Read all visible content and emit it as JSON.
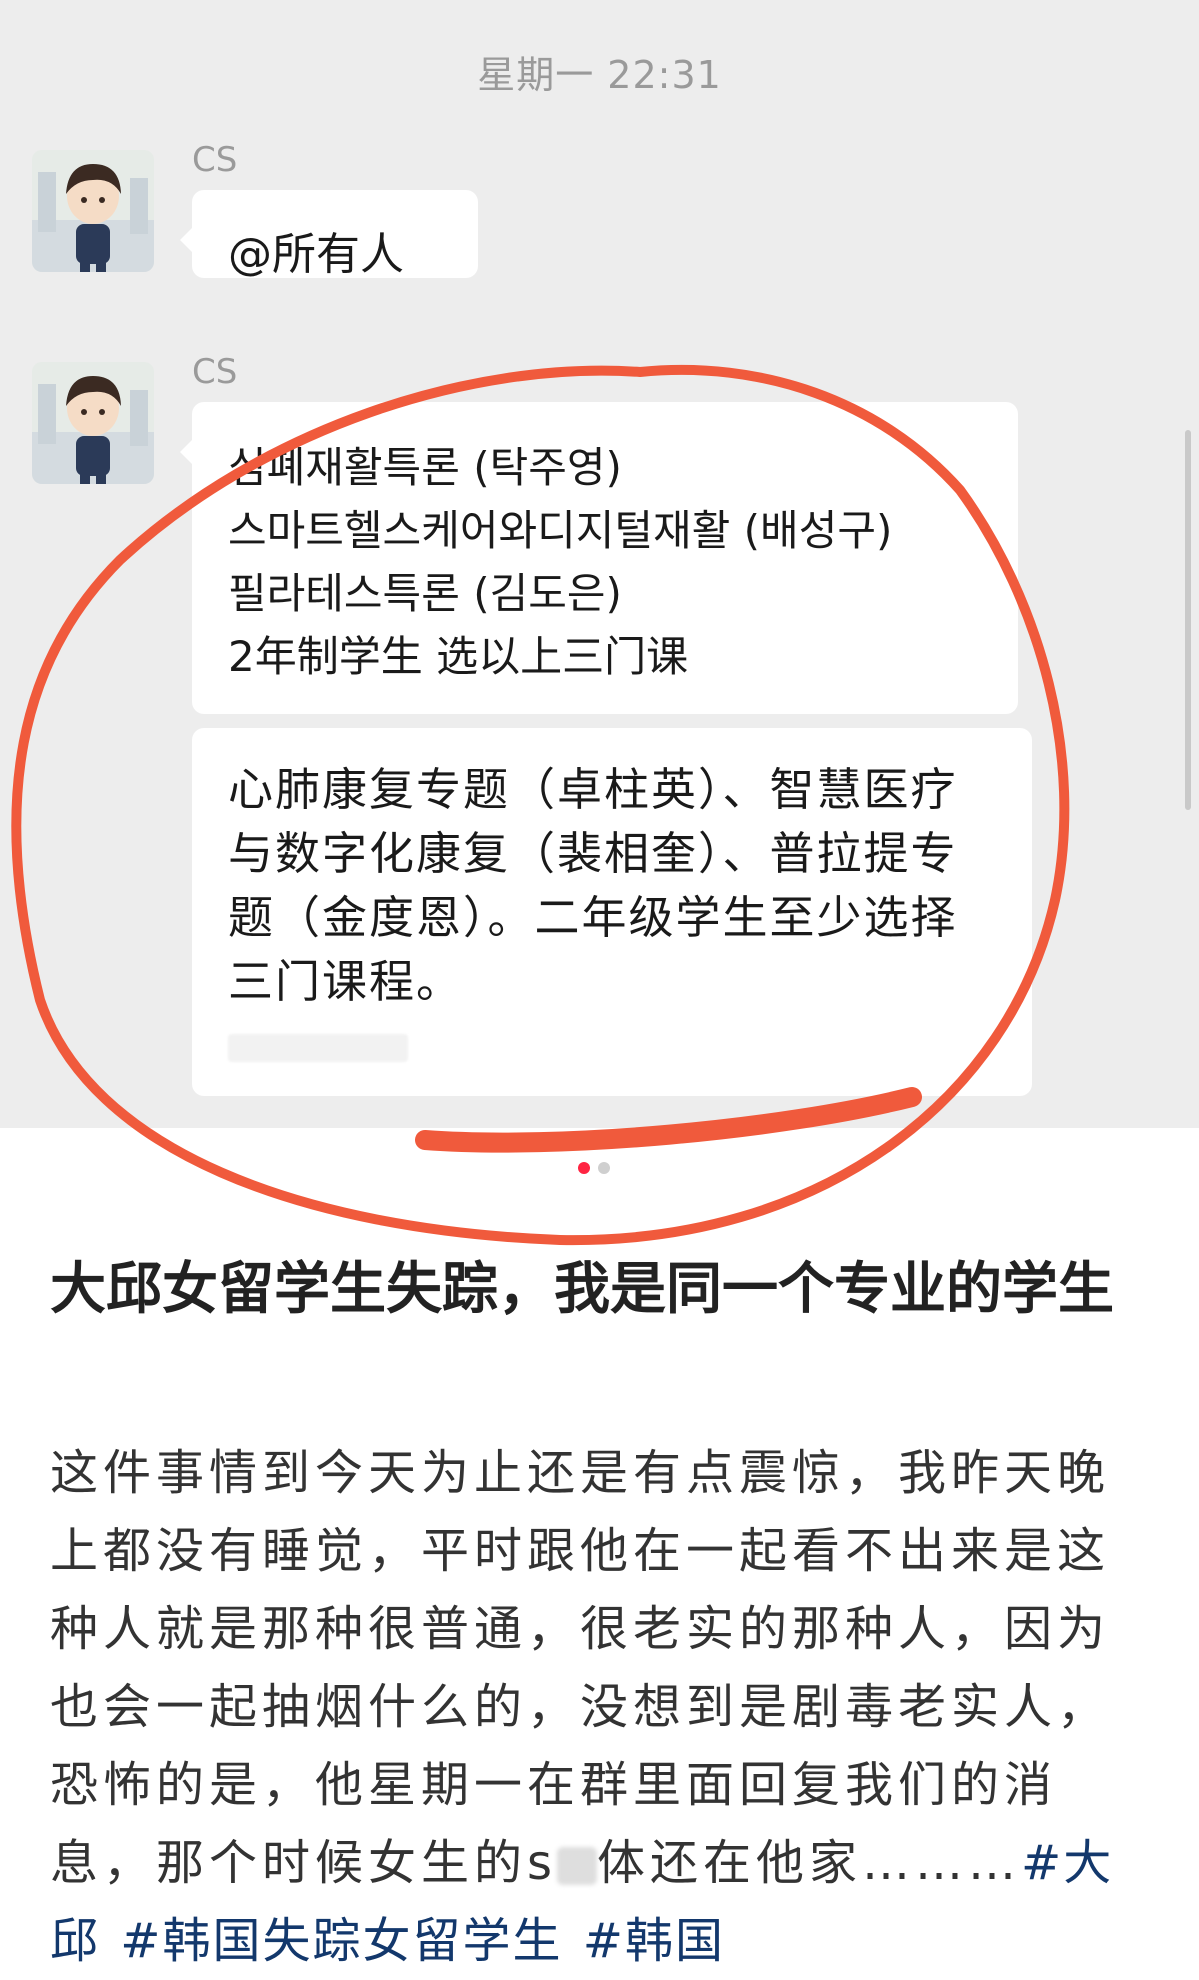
{
  "chat": {
    "timestamp": "星期一 22:31",
    "messages": [
      {
        "sender": "CS",
        "text": "@所有人"
      },
      {
        "sender": "CS",
        "text": "심폐재활특론 (탁주영)\n스마트헬스케어와디지털재활 (배성구)\n필라테스특론 (김도은)\n2年制学生 选以上三门课"
      },
      {
        "sender": "",
        "text": "心肺康复专题（卓柱英）、智慧医疗与数字化康复（裴相奎）、普拉提专题（金度恩）。二年级学生至少选择三门课程。"
      }
    ]
  },
  "annotation": {
    "color": "#f05a3c"
  },
  "carousel": {
    "count": 2,
    "active_index": 0
  },
  "post": {
    "title": "大邱女留学生失踪，我是同一个专业的学生",
    "body_before_mask": "这件事情到今天为止还是有点震惊，我昨天晚上都没有睡觉，平时跟他在一起看不出来是这种人就是那种很普通，很老实的那种人，因为也会一起抽烟什么的，没想到是剧毒老实人，恐怖的是，他星期一在群里面回复我们的消息，那个时候女生的s",
    "body_after_mask": "体还在他家………",
    "hashtags": [
      "#大邱",
      "#韩国失踪女留学生",
      "#韩国"
    ]
  }
}
